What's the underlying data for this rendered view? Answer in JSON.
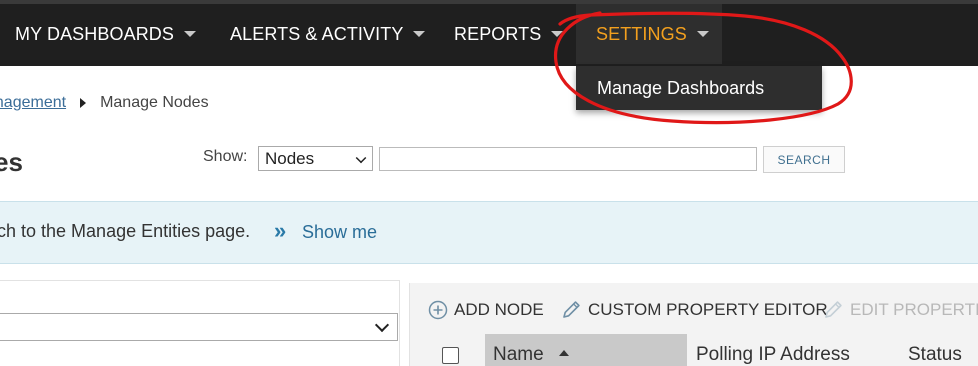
{
  "nav": {
    "items": [
      {
        "label": "MY DASHBOARDS"
      },
      {
        "label": "ALERTS & ACTIVITY"
      },
      {
        "label": "REPORTS"
      },
      {
        "label": "SETTINGS"
      }
    ],
    "active": "SETTINGS",
    "dropdown": {
      "items": [
        {
          "label": "Manage Dashboards"
        }
      ]
    }
  },
  "breadcrumb": {
    "link": "anagement",
    "current": "Manage Nodes"
  },
  "page": {
    "title": "es"
  },
  "search": {
    "show_label": "Show:",
    "show_value": "Nodes",
    "input_value": "",
    "button_label": "SEARCH"
  },
  "banner": {
    "text": "ch to the Manage Entities page.",
    "arrows": "»",
    "link": "Show me"
  },
  "toolbar": {
    "add_node": "ADD NODE",
    "custom_property_editor": "CUSTOM PROPERTY EDITOR",
    "edit_properties": "EDIT PROPERTIES"
  },
  "table": {
    "columns": [
      "Name",
      "Polling IP Address",
      "Status"
    ],
    "sorted_column": "Name",
    "sort_direction": "ascending"
  },
  "colors": {
    "nav_background": "#1f1f1f",
    "active_nav": "#f3a01e",
    "annotation": "#e01818",
    "banner_background": "#e7f3f7",
    "link": "#2a6d98"
  }
}
